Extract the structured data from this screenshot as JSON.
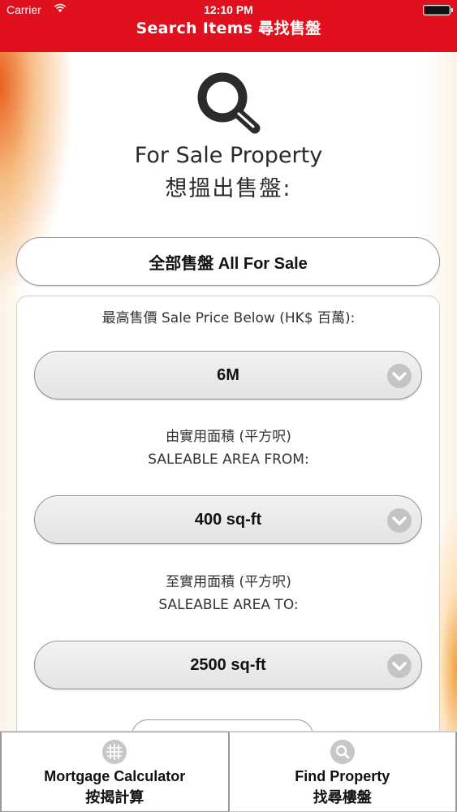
{
  "status_bar": {
    "carrier": "Carrier",
    "time": "12:10 PM"
  },
  "nav": {
    "title": "Search Items 尋找售盤"
  },
  "header": {
    "icon": "search-icon",
    "title_en": "For Sale Property",
    "title_zh": "想搵出售盤:"
  },
  "all_for_sale_button": {
    "label": "全部售盤 All For Sale"
  },
  "filters": {
    "price": {
      "label": "最高售價 Sale Price Below (HK$ 百萬):",
      "value": "6M"
    },
    "area_from": {
      "label_zh": "由實用面積 (平方呎)",
      "label_en": "SALEABLE AREA FROM:",
      "value": "400 sq-ft"
    },
    "area_to": {
      "label_zh": "至實用面積 (平方呎)",
      "label_en": "SALEABLE AREA TO:",
      "value": "2500 sq-ft"
    }
  },
  "tabbar": {
    "tabs": [
      {
        "icon": "grid-calculator-icon",
        "label_en": "Mortgage Calculator",
        "label_zh": "按揭計算"
      },
      {
        "icon": "search-icon",
        "label_en": "Find Property",
        "label_zh": "找尋樓盤"
      }
    ]
  },
  "colors": {
    "nav_red": "#e0101e",
    "accent_orange": "#e85814",
    "chevron_gray": "#c4c4c4"
  }
}
